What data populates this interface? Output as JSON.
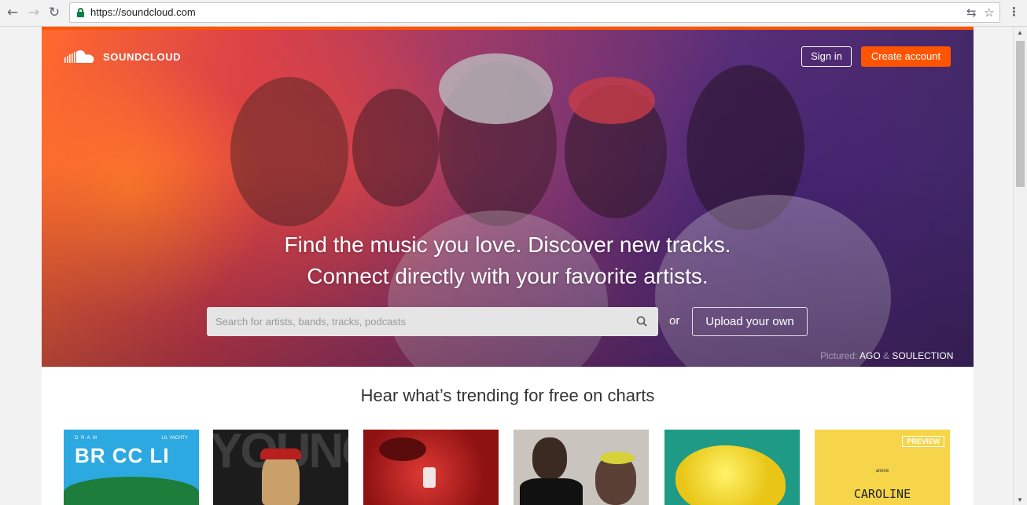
{
  "browser": {
    "back_icon": "←",
    "forward_icon": "→",
    "reload_icon": "↻",
    "url": "https://soundcloud.com",
    "translate_icon": "⇆",
    "star_icon": "☆",
    "menu_icon": "⋮"
  },
  "header": {
    "logo_text": "SOUNDCLOUD",
    "signin_label": "Sign in",
    "create_label": "Create account"
  },
  "hero": {
    "line1": "Find the music you love. Discover new tracks.",
    "line2": "Connect directly with your favorite artists.",
    "search_placeholder": "Search for artists, bands, tracks, podcasts",
    "or_text": "or",
    "upload_label": "Upload your own",
    "pictured_label": "Pictured:",
    "pictured_artist1": "AGO",
    "pictured_amp": "&",
    "pictured_artist2": "SOULECTION"
  },
  "trending": {
    "title": "Hear what’s trending for free on charts",
    "tiles": [
      {
        "title": "BR CC LI",
        "top_left": "D R A M",
        "top_right": "LIL YACHTY"
      },
      {
        "title": "YOUNG"
      },
      {
        "title": ""
      },
      {
        "title": ""
      },
      {
        "title": ""
      },
      {
        "title": "CAROLINE",
        "sub": "aminé",
        "badge": "PREVIEW"
      }
    ]
  },
  "colors": {
    "brand": "#ff5500",
    "lock": "#0b8043"
  }
}
